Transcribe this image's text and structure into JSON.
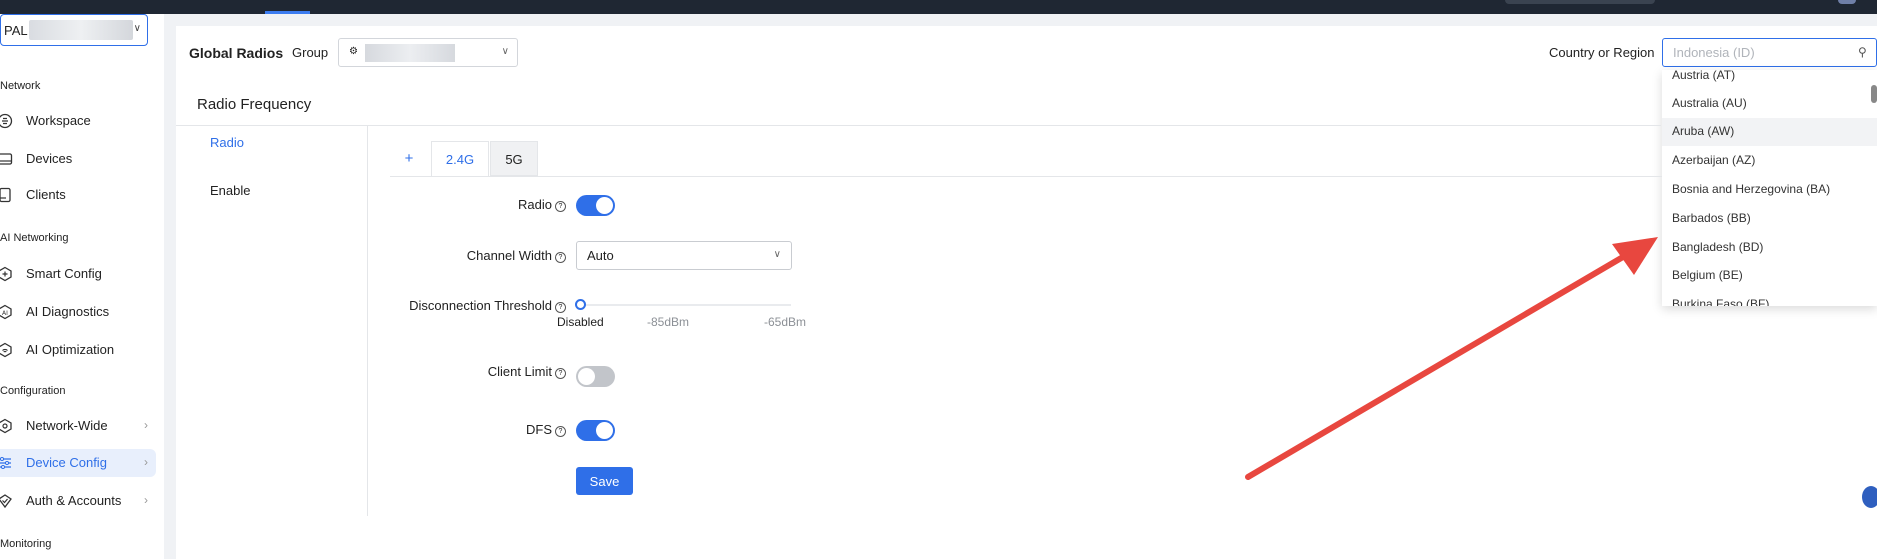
{
  "sidebar": {
    "site_select": "PAL",
    "sections": [
      {
        "label": "Network"
      },
      {
        "label": "AI Networking"
      },
      {
        "label": "Configuration"
      },
      {
        "label": "Monitoring"
      }
    ],
    "items": [
      {
        "label": "Workspace",
        "icon": "workspace-icon"
      },
      {
        "label": "Devices",
        "icon": "devices-icon"
      },
      {
        "label": "Clients",
        "icon": "clients-icon"
      },
      {
        "label": "Smart Config",
        "icon": "smart-config-icon"
      },
      {
        "label": "AI Diagnostics",
        "icon": "ai-diagnostics-icon"
      },
      {
        "label": "AI Optimization",
        "icon": "ai-optimization-icon"
      },
      {
        "label": "Network-Wide",
        "icon": "network-wide-icon"
      },
      {
        "label": "Device Config",
        "icon": "device-config-icon",
        "active": true
      },
      {
        "label": "Auth & Accounts",
        "icon": "auth-accounts-icon"
      }
    ]
  },
  "header": {
    "title": "Global Radios",
    "group_label": "Group",
    "country_label": "Country or Region",
    "country_placeholder": "Indonesia (ID)"
  },
  "country_options": [
    "Austria (AT)",
    "Australia (AU)",
    "Aruba (AW)",
    "Azerbaijan (AZ)",
    "Bosnia and Herzegovina (BA)",
    "Barbados (BB)",
    "Bangladesh (BD)",
    "Belgium (BE)",
    "Burkina Faso (BF)"
  ],
  "section": {
    "title": "Radio Frequency",
    "side_radio": "Radio",
    "side_enable": "Enable"
  },
  "tabs": {
    "add": "+",
    "band_24": "2.4G",
    "band_5": "5G"
  },
  "form": {
    "radio_label": "Radio",
    "radio_on": true,
    "channel_width_label": "Channel Width",
    "channel_width_value": "Auto",
    "disconnect_label": "Disconnection Threshold",
    "disconnect_ticks": [
      "Disabled",
      "-85dBm",
      "-65dBm"
    ],
    "client_limit_label": "Client Limit",
    "client_limit_on": false,
    "dfs_label": "DFS",
    "dfs_on": true,
    "save_label": "Save"
  },
  "colors": {
    "accent": "#2f6fe8",
    "annotation_arrow": "#e8473f"
  }
}
